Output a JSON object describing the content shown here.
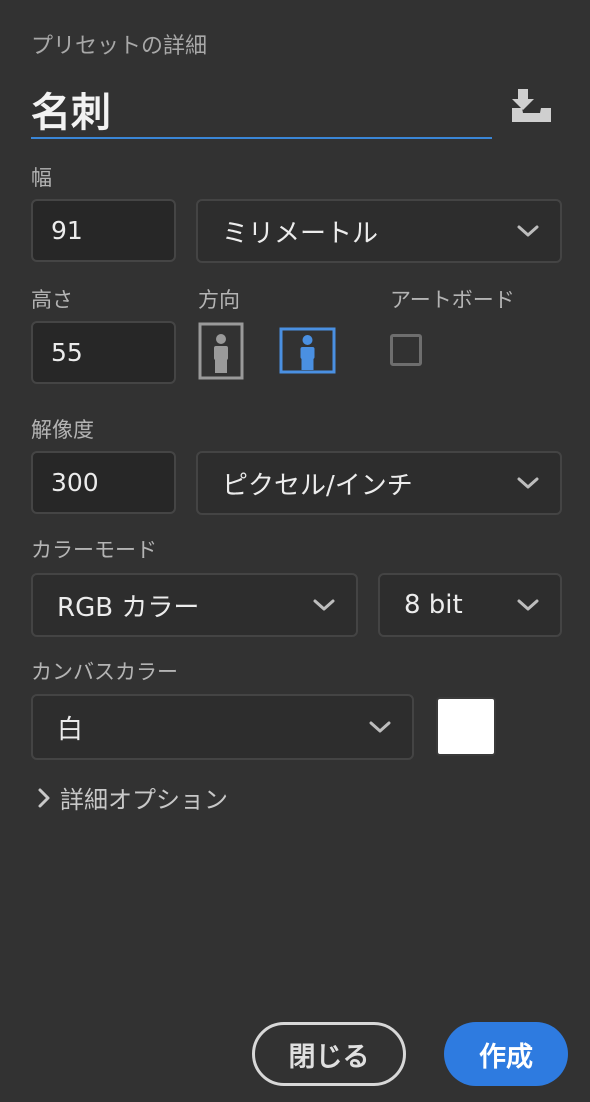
{
  "panel": {
    "title": "プリセットの詳細",
    "preset_name": "名刺"
  },
  "icons": {
    "save_preset": "save-preset-icon",
    "dropdown": "chevron-down-icon",
    "portrait": "portrait-orientation-icon",
    "landscape": "landscape-orientation-icon",
    "advanced": "chevron-right-icon"
  },
  "width": {
    "label": "幅",
    "value": "91",
    "unit": "ミリメートル"
  },
  "height": {
    "label": "高さ",
    "value": "55"
  },
  "orientation": {
    "label": "方向",
    "selected": "landscape"
  },
  "artboard": {
    "label": "アートボード",
    "checked": false
  },
  "resolution": {
    "label": "解像度",
    "value": "300",
    "unit": "ピクセル/インチ"
  },
  "color_mode": {
    "label": "カラーモード",
    "mode": "RGB カラー",
    "depth": "8 bit"
  },
  "canvas_color": {
    "label": "カンバスカラー",
    "value": "白",
    "swatch": "#ffffff"
  },
  "advanced_options": {
    "label": "詳細オプション"
  },
  "buttons": {
    "close": "閉じる",
    "create": "作成"
  },
  "colors": {
    "background": "#323232",
    "accent": "#2e7be0",
    "underline": "#3a86d6",
    "selected_orientation": "#4a90e2"
  }
}
